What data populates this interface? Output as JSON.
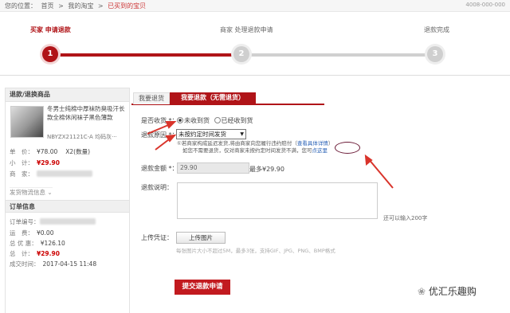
{
  "breadcrumb": {
    "label": "您的位置：",
    "home": "首页",
    "sep": ">",
    "my_taobao": "我的淘宝",
    "current": "已买到的宝贝"
  },
  "header_right": "4008-000-000",
  "steps": [
    {
      "num": "1",
      "label": "买家 申请退款",
      "active": true
    },
    {
      "num": "2",
      "label": "商家 处理退款申请",
      "active": false
    },
    {
      "num": "3",
      "label": "退款完成",
      "active": false
    }
  ],
  "sidebar": {
    "goods_title": "退款/退换商品",
    "product_name": "冬男士纯棉中厚袜防臭吸汗长款全棉休闲袜子黑色薄款",
    "sku": "NBYZX21121C-A 均码灰···",
    "unit_price_label": "单　价：",
    "unit_price": "¥78.00",
    "qty": "X2(数量)",
    "subtotal_label": "小　计：",
    "subtotal": "¥29.90",
    "merchant_label": "商　家：",
    "shipping_link": "发货物流信息",
    "order_title": "订单信息",
    "order_no_label": "订单编号：",
    "freight_label": "运　费：",
    "freight": "¥0.00",
    "discount_label": "总 优 惠：",
    "discount": "¥126.10",
    "total_label": "总　计：",
    "total": "¥29.90",
    "time_label": "成交时间：",
    "time": "2017-04-15 11:48"
  },
  "tabs": [
    "我要退货",
    "我要退款（无需退货）"
  ],
  "form": {
    "received_label": "是否收货 *：",
    "opt_not_received": "未收到货",
    "opt_received": "已经收到货",
    "reason_label": "退款原因 *：",
    "reason_value": "未按约定时间发货",
    "warn_line1": "①若商家构成延迟发货,将由商家向您履行违约赔付（",
    "warn_link1": "查看具体详情",
    "warn_line1_end": "）",
    "warn_line2": "如您不需要退货，仅对商家未按约定时间发货不满，您可",
    "warn_link2": "点这里",
    "amount_label": "退款金额 *：",
    "amount_value": "29.90",
    "amount_max": "最多¥29.90",
    "desc_label": "退款说明：",
    "desc_hint": "还可以输入200字",
    "upload_label": "上传凭证：",
    "upload_btn": "上传图片",
    "upload_hint": "每张图片大小不超过5M，最多3张，支持GIF、JPG、PNG、BMP格式",
    "submit": "提交退款申请"
  },
  "watermark": "优汇乐趣购",
  "colors": {
    "accent": "#b01418",
    "inactive": "#d0d0d0",
    "link": "#2a62b6"
  }
}
